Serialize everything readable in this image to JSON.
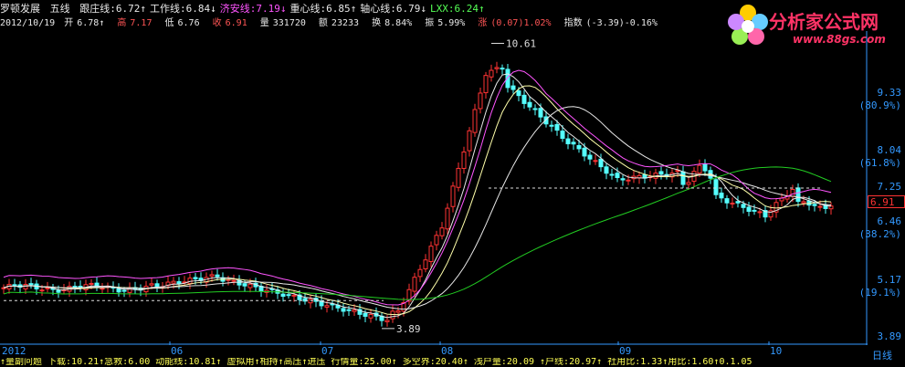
{
  "header": {
    "stock_name": "罗顿发展",
    "indicator_name": "五线",
    "items": [
      {
        "label": "跟庄线:",
        "value": "6.72↑",
        "color": "#e8e8e8"
      },
      {
        "label": "工作线:",
        "value": "6.84↓",
        "color": "#e8e8e8"
      },
      {
        "label": "济安线:",
        "value": "7.19↓",
        "color": "#ff55ff"
      },
      {
        "label": "重心线:",
        "value": "6.85↑",
        "color": "#e8e8e8"
      },
      {
        "label": "轴心线:",
        "value": "6.79↓",
        "color": "#e8e8e8"
      },
      {
        "label": "LXX:",
        "value": "6.24↑",
        "color": "#55ff55"
      }
    ]
  },
  "quote": {
    "date": "2012/10/19",
    "open_label": "开",
    "open": "6.78↑",
    "high_label": "高",
    "high": "7.17",
    "low_label": "低",
    "low": "6.76",
    "close_label": "收",
    "close": "6.91",
    "volume_label": "量",
    "volume": "331720",
    "amount_label": "额",
    "amount": "23233",
    "turnover_label": "换",
    "turnover": "8.84%",
    "amplitude_label": "振",
    "amplitude": "5.99%",
    "change_label": "涨",
    "change": "(0.07)1.02%",
    "index_label": "指数",
    "index": "(-3.39)-0.16%"
  },
  "logo": {
    "title": "分析家公式网",
    "url": "www.88gs.com"
  },
  "right_axis": [
    {
      "price": "9.33",
      "pct": "(80.9%)"
    },
    {
      "price": "8.04",
      "pct": "(61.8%)"
    },
    {
      "price": "7.25",
      "pct": ""
    },
    {
      "price": "6.46",
      "pct": "(38.2%)"
    },
    {
      "price": "5.17",
      "pct": "(19.1%)"
    },
    {
      "price": "3.89",
      "pct": ""
    }
  ],
  "current_price": "6.91",
  "x_labels": [
    "2012",
    "06",
    "07",
    "08",
    "09",
    "10"
  ],
  "timeframe": "日线",
  "annotations": {
    "high": "10.61",
    "low": "3.89"
  },
  "bottom_strip": "↑量副问题  下载:10.21↑急救:6.00  动能线:10.81↑  虚拟用↑相持↑高压↑进压  行情量:25.00↑  多空界:20.40↑  浅户量:20.09  ↑户线:20.97↑  社用比:1.33↑用比:1.60↑0.1.05",
  "colors": {
    "up": "#ff3333",
    "down": "#55ffff",
    "ma_white": "#e8e8e8",
    "ma_yellow": "#ffffaa",
    "ma_magenta": "#ff55ff",
    "ma_green": "#22cc22",
    "axis": "#3399ff"
  },
  "chart_data": {
    "type": "line",
    "title": "",
    "y_range": [
      3.89,
      10.61
    ],
    "note_series": [
      {
        "name": "济安线",
        "color": "#ff55ff"
      },
      {
        "name": "LXX",
        "color": "#22cc22"
      }
    ]
  }
}
